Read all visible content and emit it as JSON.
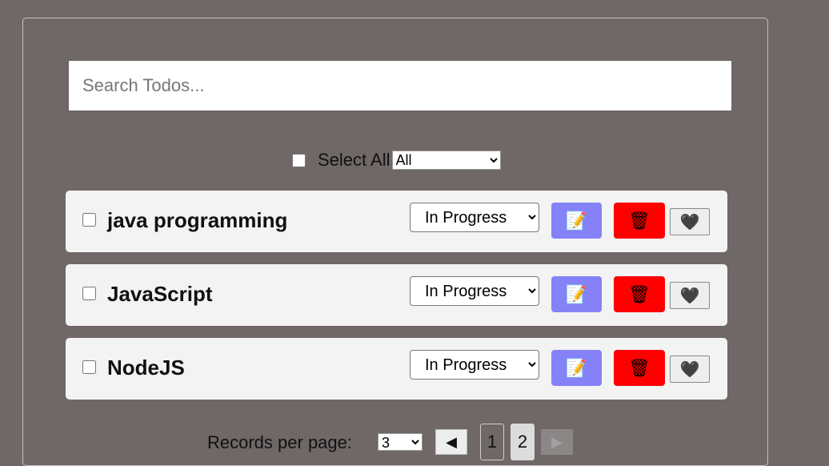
{
  "search": {
    "placeholder": "Search Todos...",
    "value": ""
  },
  "filter": {
    "select_all_label": "Select All",
    "selected": "All",
    "options": [
      "All"
    ]
  },
  "status_options": [
    "In Progress"
  ],
  "todos": [
    {
      "title": "java programming",
      "status": "In Progress"
    },
    {
      "title": "JavaScript",
      "status": "In Progress"
    },
    {
      "title": "NodeJS",
      "status": "In Progress"
    }
  ],
  "icons": {
    "edit": "memo-icon",
    "delete": "wastebasket-icon",
    "favorite": "black-heart-icon"
  },
  "colors": {
    "background": "#706767",
    "card": "#f3f3f3",
    "edit_button": "#8582f7",
    "delete_button": "#ff0000"
  },
  "pagination": {
    "records_label": "Records per page:",
    "records_per_page": "3",
    "pages": [
      "1",
      "2"
    ],
    "current_page": "2",
    "prev_symbol": "◀",
    "next_symbol": "▶"
  }
}
